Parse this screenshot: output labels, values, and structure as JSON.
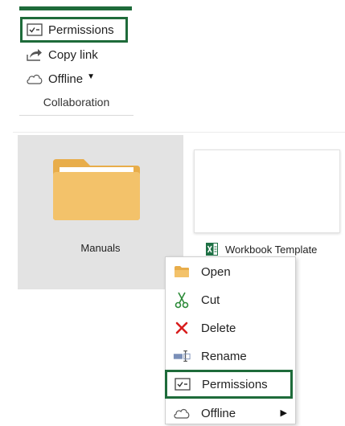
{
  "ribbon": {
    "buttons": [
      {
        "label": "Permissions",
        "icon": "permissions-icon"
      },
      {
        "label": "Copy link",
        "icon": "share-arrow-icon"
      },
      {
        "label": "Offline",
        "icon": "cloud-icon",
        "has_dropdown": true
      }
    ],
    "group_label": "Collaboration"
  },
  "explorer": {
    "items": [
      {
        "label": "Manuals",
        "type": "folder",
        "selected": true
      },
      {
        "label": "Workbook Template",
        "type": "excel-file"
      }
    ]
  },
  "context_menu": {
    "items": [
      {
        "label": "Open",
        "icon": "folder-icon"
      },
      {
        "label": "Cut",
        "icon": "scissors-icon"
      },
      {
        "label": "Delete",
        "icon": "delete-x-icon"
      },
      {
        "label": "Rename",
        "icon": "rename-icon"
      },
      {
        "label": "Permissions",
        "icon": "permissions-icon",
        "highlighted": true
      },
      {
        "label": "Offline",
        "icon": "cloud-icon",
        "has_submenu": true
      }
    ]
  },
  "colors": {
    "highlight_green": "#1e6b3a",
    "folder_yellow": "#f3c26a",
    "delete_red": "#d81e1e",
    "excel_green": "#1e7145",
    "selected_tile": "#e3e3e3"
  }
}
